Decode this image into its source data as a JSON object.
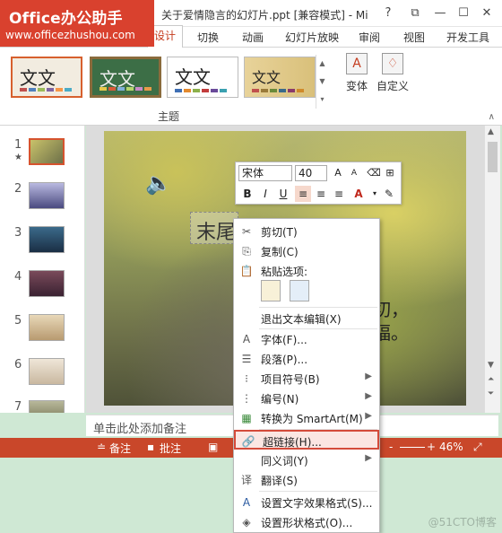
{
  "titlebar": {
    "logo_title": "Office办公助手",
    "logo_url": "www.officezhushou.com",
    "document_title": "关于爱情隐言的幻灯片.ppt [兼容模式] - Micr...",
    "help": "?",
    "restore": "⧉",
    "minimize": "—",
    "maximize": "☐",
    "close": "✕"
  },
  "tabs": {
    "design": "设计",
    "transitions": "切换",
    "animations": "动画",
    "slideshow": "幻灯片放映",
    "review": "审阅",
    "view": "视图",
    "developer": "开发工具"
  },
  "ribbon": {
    "themes": [
      {
        "label": "文文",
        "bg": "#f2ece0",
        "border": "#d7602e"
      },
      {
        "label": "文文",
        "bg": "#3c6e46",
        "border": "#8a6b3c"
      },
      {
        "label": "文文",
        "bg": "#ffffff",
        "border": "#bcbcbc"
      },
      {
        "label": "文文",
        "bg": "#e8d39a",
        "border": "#bcbcbc"
      }
    ],
    "group_label": "主题",
    "variants_label": "变体",
    "customize_label": "自定义",
    "customize_icon": "♢",
    "variants_icon": "A"
  },
  "thumbnails": [
    {
      "num": "1",
      "star": "★",
      "color": "#8a8a3c"
    },
    {
      "num": "2",
      "star": "",
      "color": "#6a6aa0"
    },
    {
      "num": "3",
      "star": "",
      "color": "#2e4d6a"
    },
    {
      "num": "4",
      "star": "",
      "color": "#5a3a4a"
    },
    {
      "num": "5",
      "star": "",
      "color": "#b89a70"
    },
    {
      "num": "6",
      "star": "",
      "color": "#c9b8a0"
    },
    {
      "num": "7",
      "star": "",
      "color": "#8a8a6a"
    }
  ],
  "slide": {
    "title_text": "末尾",
    "body_text": "切，\n福。",
    "speaker_icon": "🔈"
  },
  "notes": {
    "placeholder": "单击此处添加备注"
  },
  "statusbar": {
    "notes": "备注",
    "comments": "批注",
    "zoom": "46%",
    "zoom_minus": "-",
    "zoom_plus": "+"
  },
  "mini_toolbar": {
    "font": "宋体",
    "size": "40",
    "grow": "A",
    "shrink": "A",
    "bold": "B",
    "italic": "I",
    "underline": "U",
    "font_color": "A"
  },
  "context_menu": {
    "cut": "剪切(T)",
    "copy": "复制(C)",
    "paste_options": "粘贴选项:",
    "exit_edit": "退出文本编辑(X)",
    "font": "字体(F)...",
    "paragraph": "段落(P)...",
    "bullets": "项目符号(B)",
    "numbering": "编号(N)",
    "smartart": "转换为 SmartArt(M)",
    "hyperlink": "超链接(H)...",
    "synonyms": "同义词(Y)",
    "translate": "翻译(S)",
    "format_text_effects": "设置文字效果格式(S)...",
    "format_shape": "设置形状格式(O)..."
  },
  "watermark": "@51CTO博客"
}
